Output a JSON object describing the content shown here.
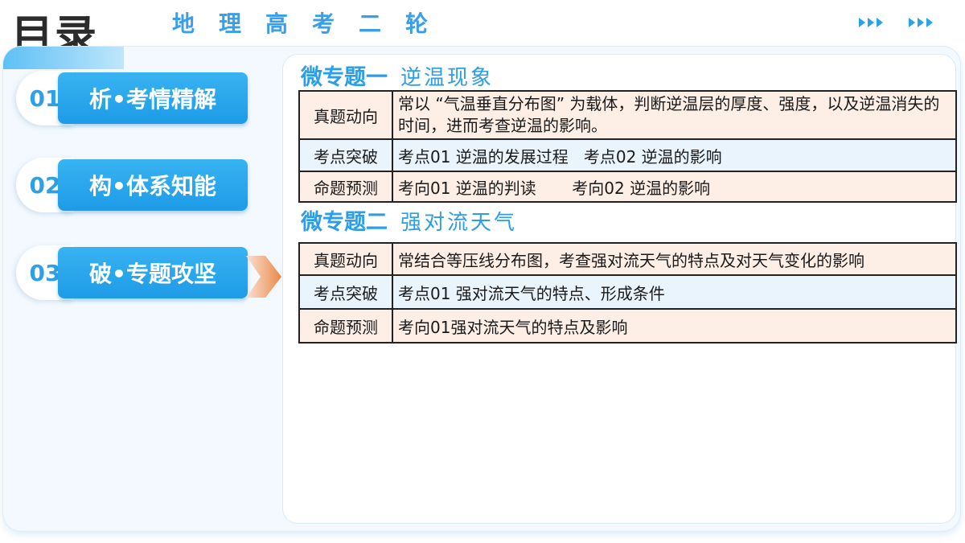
{
  "header": {
    "title": "目录",
    "subtitle": "地理高考二轮"
  },
  "nav": [
    {
      "num": "01",
      "label": "析•考情精解"
    },
    {
      "num": "02",
      "label": "构•体系知能"
    },
    {
      "num": "03",
      "label": "破•专题攻坚"
    }
  ],
  "sections": [
    {
      "heading": "微专题一",
      "topic": "逆温现象",
      "rows": [
        {
          "key": "真题动向",
          "value": "常以 “气温垂直分布图” 为载体，判断逆温层的厚度、强度，以及逆温消失的时间，进而考查逆温的影响。"
        },
        {
          "key": "考点突破",
          "value": "考点01 逆温的发展过程   考点02 逆温的影响"
        },
        {
          "key": "命题预测",
          "value": "考向01 逆温的判读       考向02 逆温的影响"
        }
      ]
    },
    {
      "heading": "微专题二",
      "topic": "强对流天气",
      "rows": [
        {
          "key": "真题动向",
          "value": "常结合等压线分布图，考查强对流天气的特点及对天气变化的影响"
        },
        {
          "key": "考点突破",
          "value": "考点01 强对流天气的特点、形成条件"
        },
        {
          "key": "命题预测",
          "value": "考向01强对流天气的特点及影响"
        }
      ]
    }
  ],
  "colors": {
    "accent": "#2c9de8",
    "pointer": "#e9884a"
  }
}
